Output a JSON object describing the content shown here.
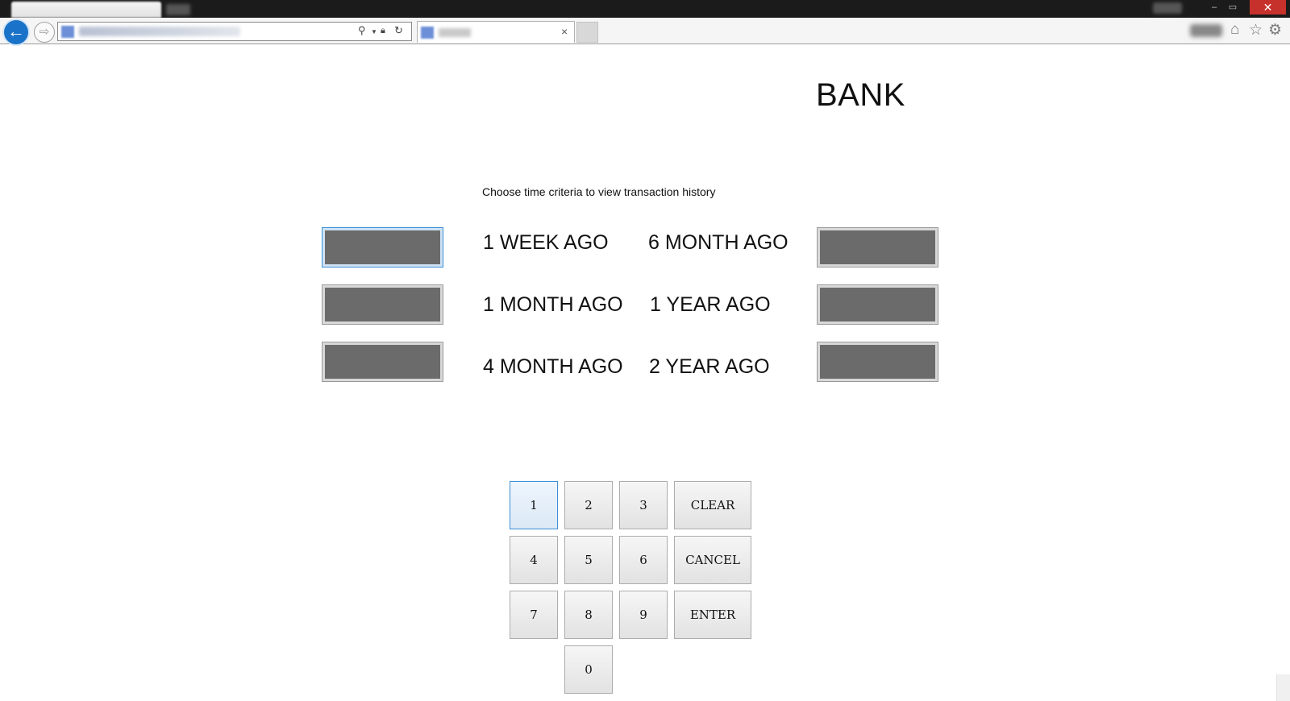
{
  "browser": {
    "close_glyph": "✕",
    "minimize_glyph": "–",
    "maximize_glyph": "▭",
    "back_glyph": "←",
    "forward_glyph": "⇨",
    "tab_close_glyph": "×",
    "icons": [
      "search-icon",
      "lock-icon",
      "refresh-icon",
      "home-icon",
      "star-icon",
      "gear-icon"
    ]
  },
  "page": {
    "title": "BANK",
    "instructions": "Choose time criteria to view transaction history",
    "options": {
      "left": [
        "1 WEEK AGO",
        "1 MONTH AGO",
        "4 MONTH AGO"
      ],
      "right": [
        "6 MONTH AGO",
        "1 YEAR AGO",
        "2 YEAR AGO"
      ]
    },
    "keypad": {
      "digits": [
        "1",
        "2",
        "3",
        "4",
        "5",
        "6",
        "7",
        "8",
        "9",
        "0"
      ],
      "clear": "CLEAR",
      "cancel": "CANCEL",
      "enter": "ENTER"
    }
  },
  "colors": {
    "side_button": "#6b6b6b",
    "focus_accent": "#3c8fd6",
    "back_button": "#1a73c9",
    "close_button": "#c7312b"
  }
}
